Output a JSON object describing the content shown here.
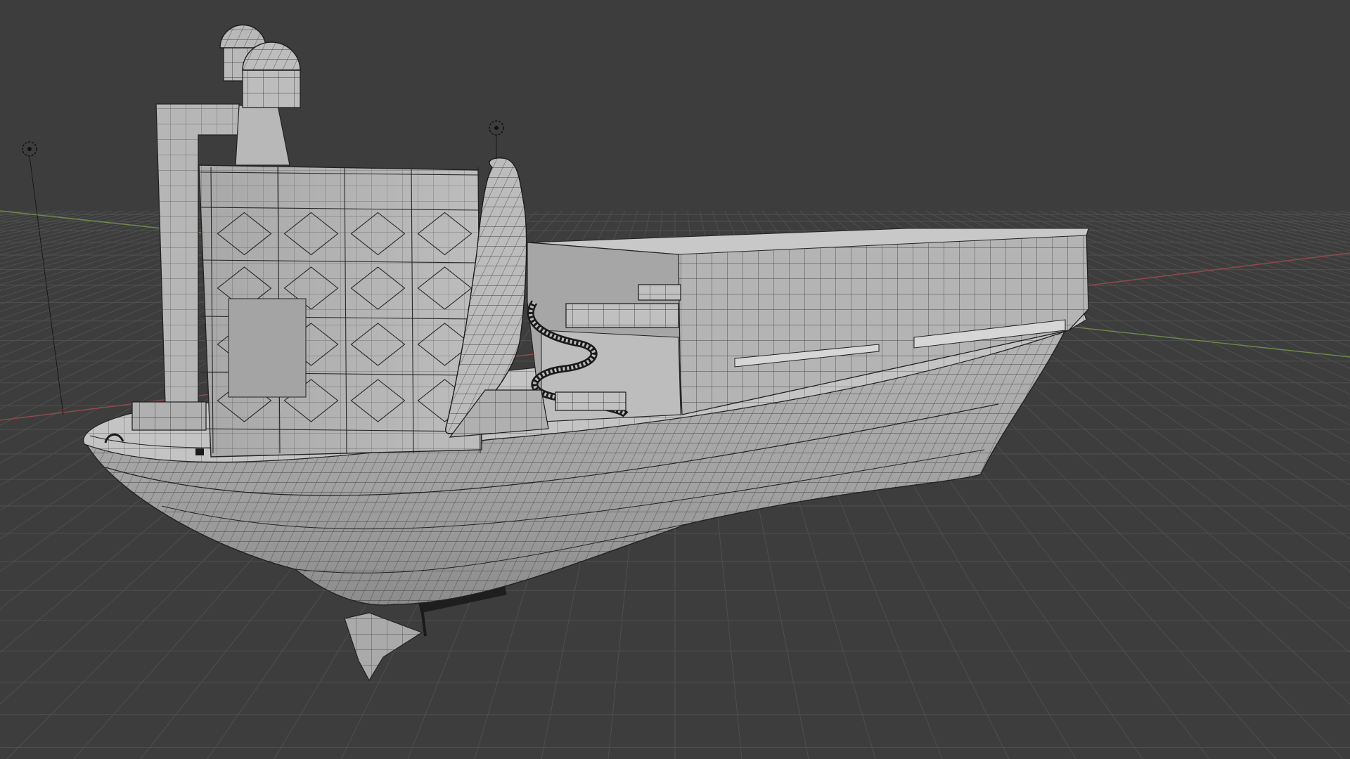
{
  "viewport": {
    "background": "#3d3d3d",
    "grid_color": "#4f4f4f",
    "x_axis_color": "#8a4a4a",
    "y_axis_color": "#6f8a4a",
    "mesh_fill": "#b9b9b9",
    "mesh_fill_dark": "#8e8e8e",
    "wire_color": "#2a2a2a"
  },
  "objects": [
    {
      "name": "ship-hull",
      "type": "mesh"
    },
    {
      "name": "bow-figurehead",
      "type": "mesh"
    },
    {
      "name": "stern-tower",
      "type": "mesh"
    },
    {
      "name": "spiral-staircase",
      "type": "mesh"
    },
    {
      "name": "rudder-keel",
      "type": "mesh"
    }
  ],
  "lights": [
    {
      "name": "light-left",
      "icon": "light-icon"
    },
    {
      "name": "light-center",
      "icon": "light-icon"
    }
  ]
}
